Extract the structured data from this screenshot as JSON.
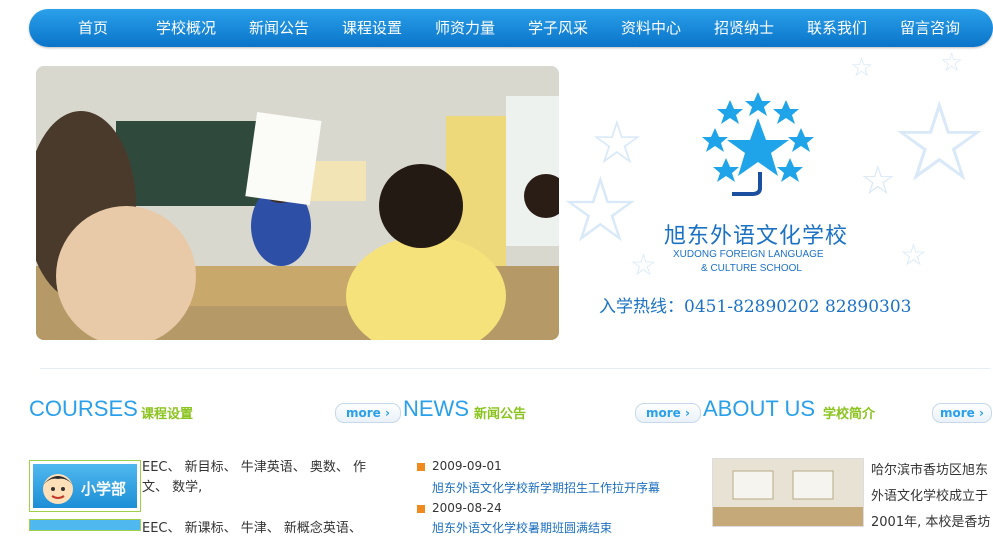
{
  "nav": {
    "items": [
      "首页",
      "学校概况",
      "新闻公告",
      "课程设置",
      "师资力量",
      "学子风采",
      "资料中心",
      "招贤纳士",
      "联系我们",
      "留言咨询"
    ]
  },
  "school": {
    "name_cn": "旭东外语文化学校",
    "name_en_line1": "XUDONG FOREIGN LANGUAGE",
    "name_en_line2": "& CULTURE SCHOOL",
    "hotline": "入学热线：0451-82890202 82890303"
  },
  "sections": {
    "courses": {
      "title": "COURSES",
      "subtitle": "课程设置",
      "more": "more"
    },
    "news": {
      "title": "NEWS",
      "subtitle": "新闻公告",
      "more": "more"
    },
    "about": {
      "title": "ABOUT US",
      "subtitle": "学校简介",
      "more": "more"
    }
  },
  "courses": {
    "dept1_label": "小学部",
    "dept1_text": "EEC、 新目标、 牛津英语、 奥数、 作文、 数学,",
    "dept2_text": "EEC、 新课标、 牛津、 新概念英语、"
  },
  "news": {
    "items": [
      {
        "date": "2009-09-01",
        "title": "旭东外语文化学校新学期招生工作拉开序幕"
      },
      {
        "date": "2009-08-24",
        "title": "旭东外语文化学校暑期班圆满结束"
      }
    ]
  },
  "about": {
    "text": "哈尔滨市香坊区旭东外语文化学校成立于2001年, 本校是香坊"
  },
  "colors": {
    "nav_blue": "#0a74c9",
    "accent_blue": "#2aa0ea",
    "subtitle_green": "#8bc31f",
    "bullet_orange": "#f08a1e"
  },
  "icons": {
    "more": "chevron-right-icon",
    "bullet": "square-bullet-icon",
    "logo": "star-circle-logo"
  }
}
